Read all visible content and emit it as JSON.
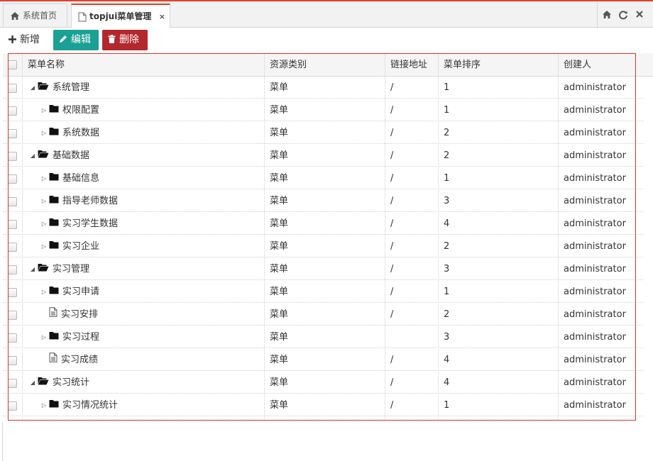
{
  "tabs": [
    {
      "label": "系统首页",
      "icon": "home-icon"
    },
    {
      "label": "topjui菜单管理",
      "icon": "file-icon",
      "close": "×"
    }
  ],
  "tab_tools": [
    "home-icon",
    "refresh-icon",
    "close-all-icon"
  ],
  "toolbar": {
    "add_label": "新增",
    "edit_label": "编辑",
    "delete_label": "删除"
  },
  "colors": {
    "accent": "#e1412d",
    "edit_button": "#1aa094",
    "delete_button": "#b2282c",
    "selection_box": "#d9342b"
  },
  "table": {
    "headers": [
      "菜单名称",
      "资源类别",
      "链接地址",
      "菜单排序",
      "创建人"
    ],
    "rows": [
      {
        "name": "系统管理",
        "level": 0,
        "node": "folder-open",
        "expander": "expanded",
        "type": "菜单",
        "link": "/",
        "order": "1",
        "creator": "administrator"
      },
      {
        "name": "权限配置",
        "level": 1,
        "node": "folder",
        "expander": "collapsed",
        "type": "菜单",
        "link": "/",
        "order": "1",
        "creator": "administrator"
      },
      {
        "name": "系统数据",
        "level": 1,
        "node": "folder",
        "expander": "collapsed",
        "type": "菜单",
        "link": "/",
        "order": "2",
        "creator": "administrator"
      },
      {
        "name": "基础数据",
        "level": 0,
        "node": "folder-open",
        "expander": "expanded",
        "type": "菜单",
        "link": "/",
        "order": "2",
        "creator": "administrator"
      },
      {
        "name": "基础信息",
        "level": 1,
        "node": "folder",
        "expander": "collapsed",
        "type": "菜单",
        "link": "/",
        "order": "1",
        "creator": "administrator"
      },
      {
        "name": "指导老师数据",
        "level": 1,
        "node": "folder",
        "expander": "collapsed",
        "type": "菜单",
        "link": "/",
        "order": "3",
        "creator": "administrator"
      },
      {
        "name": "实习学生数据",
        "level": 1,
        "node": "folder",
        "expander": "collapsed",
        "type": "菜单",
        "link": "/",
        "order": "4",
        "creator": "administrator"
      },
      {
        "name": "实习企业",
        "level": 1,
        "node": "folder",
        "expander": "collapsed",
        "type": "菜单",
        "link": "/",
        "order": "2",
        "creator": "administrator"
      },
      {
        "name": "实习管理",
        "level": 0,
        "node": "folder-open",
        "expander": "expanded",
        "type": "菜单",
        "link": "/",
        "order": "3",
        "creator": "administrator"
      },
      {
        "name": "实习申请",
        "level": 1,
        "node": "folder",
        "expander": "collapsed",
        "type": "菜单",
        "link": "/",
        "order": "1",
        "creator": "administrator"
      },
      {
        "name": "实习安排",
        "level": 1,
        "node": "file",
        "expander": "none",
        "type": "菜单",
        "link": "/",
        "order": "2",
        "creator": "administrator"
      },
      {
        "name": "实习过程",
        "level": 1,
        "node": "folder",
        "expander": "collapsed",
        "type": "菜单",
        "link": "",
        "order": "3",
        "creator": "administrator"
      },
      {
        "name": "实习成绩",
        "level": 1,
        "node": "file",
        "expander": "none",
        "type": "菜单",
        "link": "/",
        "order": "4",
        "creator": "administrator"
      },
      {
        "name": "实习统计",
        "level": 0,
        "node": "folder-open",
        "expander": "expanded",
        "type": "菜单",
        "link": "/",
        "order": "4",
        "creator": "administrator"
      },
      {
        "name": "实习情况统计",
        "level": 1,
        "node": "folder",
        "expander": "collapsed",
        "type": "菜单",
        "link": "/",
        "order": "1",
        "creator": "administrator"
      }
    ]
  }
}
